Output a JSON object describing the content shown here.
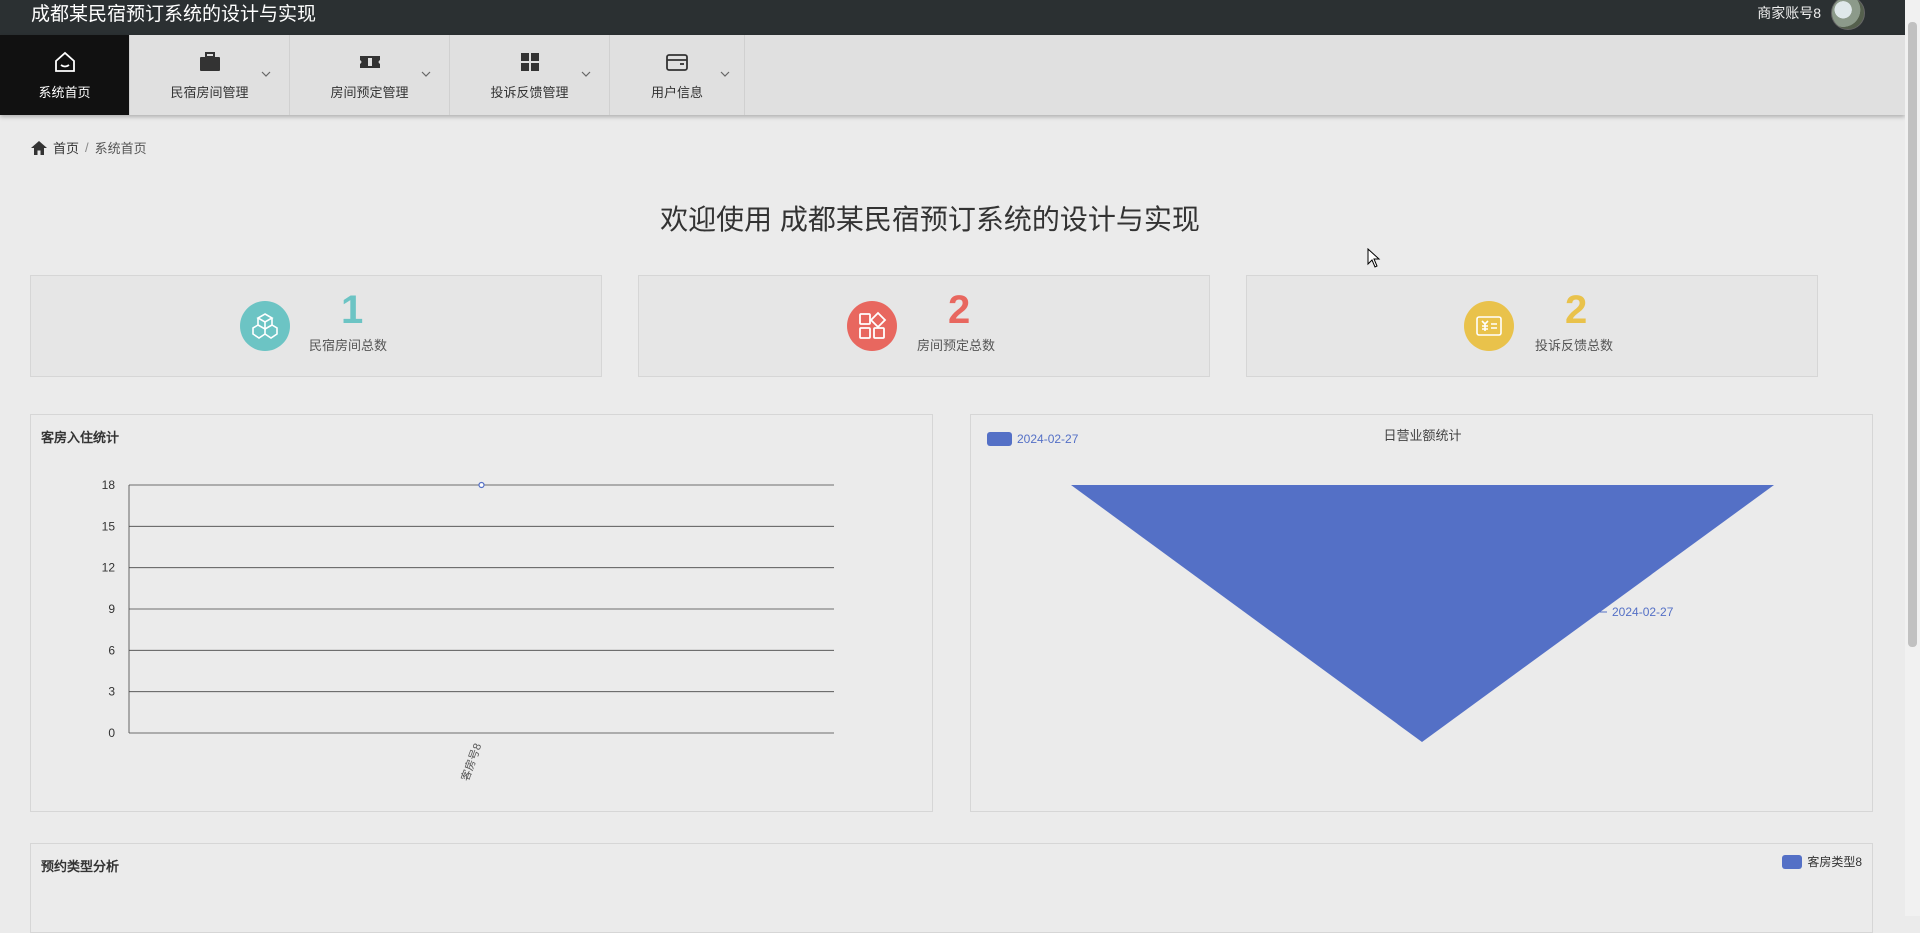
{
  "header": {
    "title": "成都某民宿预订系统的设计与实现",
    "user": "商家账号8"
  },
  "nav": [
    {
      "label": "系统首页",
      "icon": "home-icon"
    },
    {
      "label": "民宿房间管理",
      "icon": "briefcase-icon"
    },
    {
      "label": "房间预定管理",
      "icon": "ticket-icon"
    },
    {
      "label": "投诉反馈管理",
      "icon": "grid-icon"
    },
    {
      "label": "用户信息",
      "icon": "card-icon"
    }
  ],
  "breadcrumb": {
    "home": "首页",
    "separator": "/",
    "current": "系统首页"
  },
  "welcome": "欢迎使用 成都某民宿预订系统的设计与实现",
  "stats": [
    {
      "value": "1",
      "label": "民宿房间总数",
      "color": "#6cc4c4",
      "icon": "cubes-icon"
    },
    {
      "value": "2",
      "label": "房间预定总数",
      "color": "#e8675f",
      "icon": "apps-icon"
    },
    {
      "value": "2",
      "label": "投诉反馈总数",
      "color": "#e9c24b",
      "icon": "invoice-icon"
    }
  ],
  "panels": {
    "occupancy_title": "客房入住统计",
    "revenue_title": "日营业额统计",
    "reservation_title": "预约类型分析",
    "reservation_legend": "客房类型8"
  },
  "chart_data": [
    {
      "type": "line",
      "title": "客房入住统计",
      "categories": [
        "客房号8"
      ],
      "values": [
        18
      ],
      "ylim": [
        0,
        18
      ],
      "yticks": [
        "0",
        "3",
        "6",
        "9",
        "12",
        "15",
        "18"
      ],
      "grid": true,
      "color": "#5470c6"
    },
    {
      "type": "funnel",
      "title": "日营业额统计",
      "series": [
        {
          "name": "2024-02-27",
          "values": [
            1
          ]
        }
      ],
      "labels": [
        "2024-02-27"
      ],
      "legend": "top-left",
      "color": "#5470c6"
    }
  ]
}
